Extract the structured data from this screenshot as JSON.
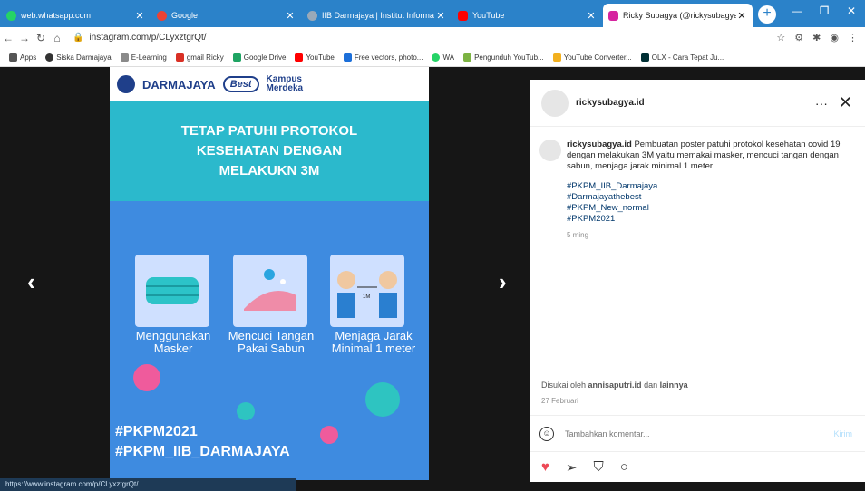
{
  "tabs": [
    {
      "title": "web.whatsapp.com",
      "fav": "#25d366"
    },
    {
      "title": "Google",
      "fav": "#ea4335"
    },
    {
      "title": "IIB Darmajaya | Institut Informa",
      "fav": "#9aa9b8"
    },
    {
      "title": "YouTube",
      "fav": "#ff0000"
    },
    {
      "title": "Ricky Subagya (@rickysubagya",
      "fav": "#d6249f"
    }
  ],
  "addr": {
    "url": "instagram.com/p/CLyxztgrQt/"
  },
  "bookmarks": [
    {
      "t": "Apps",
      "c": "#555"
    },
    {
      "t": "Siska Darmajaya",
      "c": "#333"
    },
    {
      "t": "E-Learning",
      "c": "#8a8a8a"
    },
    {
      "t": "gmail Ricky",
      "c": "#d93025"
    },
    {
      "t": "Google Drive",
      "c": "#1fa463"
    },
    {
      "t": "YouTube",
      "c": "#ff0000"
    },
    {
      "t": "Free vectors, photo...",
      "c": "#1c6fd9"
    },
    {
      "t": "WA",
      "c": "#25d366"
    },
    {
      "t": "Pengunduh YouTub...",
      "c": "#7cb342"
    },
    {
      "t": "YouTube Converter...",
      "c": "#f2b01e"
    },
    {
      "t": "OLX - Cara Tepat Ju...",
      "c": "#002f34"
    }
  ],
  "poster": {
    "dj": "DARMAJAYA",
    "best": "Best",
    "km1": "Kampus",
    "km2": "Merdeka",
    "h1": "TETAP PATUHI PROTOKOL",
    "h2": "KESEHATAN DENGAN",
    "h3": "MELAKUKN 3M",
    "l1a": "Menggunakan",
    "l1b": "Masker",
    "l2a": "Mencuci Tangan",
    "l2b": "Pakai Sabun",
    "l3a": "Menjaga Jarak",
    "l3b": "Minimal 1 meter",
    "t1": "#PKPM2021",
    "t2": "#PKPM_IIB_DARMAJAYA",
    "dist": "1M"
  },
  "status": "https://www.instagram.com/p/CLyxztgrQt/",
  "side": {
    "user": "rickysubagya.id",
    "capUser": "rickysubagya.id",
    "capText": "Pembuatan poster patuhi protokol kesehatan covid 19 dengan melakukan 3M yaitu memakai masker, mencuci tangan dengan sabun, menjaga jarak minimal 1 meter",
    "tags": [
      "#PKPM_IIB_Darmajaya",
      "#Darmajayathebest",
      "#PKPM_New_normal",
      "#PKPM2021"
    ],
    "time": "5 ming",
    "likesPre": "Disukai oleh",
    "likesUser": "annisaputri.id",
    "likesMid": "dan",
    "likesEnd": "lainnya",
    "date": "27 Februari",
    "placeholder": "Tambahkan komentar...",
    "send": "Kirim"
  },
  "colors": {
    "tabbar": "#2b82c9",
    "heart": "#ed4956"
  }
}
